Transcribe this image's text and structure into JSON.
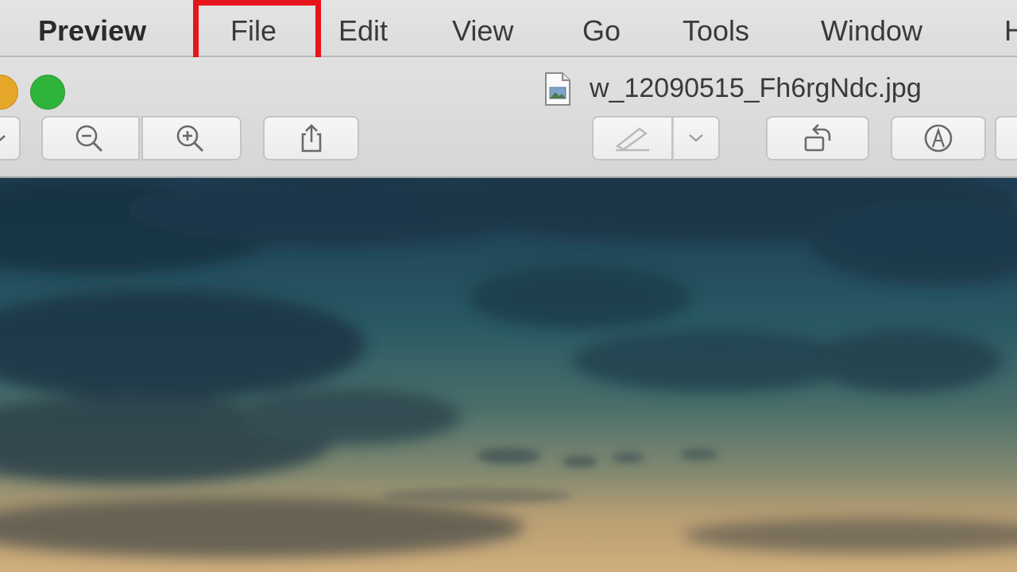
{
  "menubar": {
    "app_name": "Preview",
    "items": [
      "File",
      "Edit",
      "View",
      "Go",
      "Tools",
      "Window",
      "H"
    ],
    "highlighted_item": "File",
    "highlight_color": "#e8141c"
  },
  "window": {
    "document_title": "w_12090515_Fh6rgNdc.jpg",
    "document_icon": "jpeg-file-icon",
    "traffic_lights": [
      {
        "name": "minimize-button",
        "color": "#e6a62a"
      },
      {
        "name": "zoom-button",
        "color": "#2fb43a"
      }
    ]
  },
  "toolbar": {
    "buttons": [
      {
        "name": "sidebar-view-button",
        "icon": "chevron-down-icon"
      },
      {
        "name": "zoom-out-button",
        "icon": "magnifier-minus-icon"
      },
      {
        "name": "zoom-in-button",
        "icon": "magnifier-plus-icon"
      },
      {
        "name": "share-button",
        "icon": "share-icon"
      },
      {
        "name": "markup-button",
        "icon": "pen-icon",
        "enabled": false
      },
      {
        "name": "markup-dropdown-button",
        "icon": "chevron-down-icon"
      },
      {
        "name": "rotate-button",
        "icon": "rotate-left-icon"
      },
      {
        "name": "markup-toolbar-button",
        "icon": "markup-pen-circle-icon"
      }
    ]
  },
  "content": {
    "image_description_icon": "photo-sky-image"
  }
}
